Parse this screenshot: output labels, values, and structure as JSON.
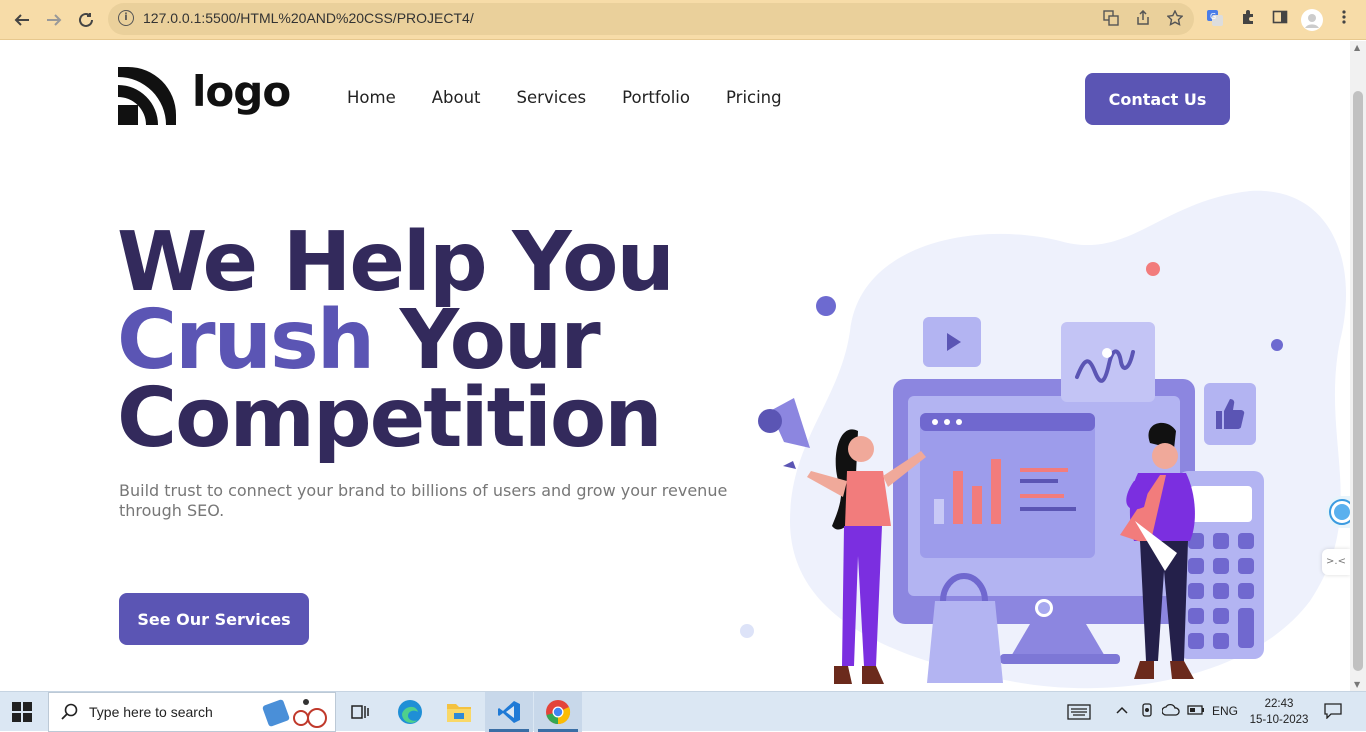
{
  "browser": {
    "url": "127.0.0.1:5500/HTML%20AND%20CSS/PROJECT4/",
    "icons": [
      "back-icon",
      "forward-icon",
      "reload-icon",
      "site-info-icon",
      "translate-icon",
      "share-icon",
      "bookmark-star-icon",
      "google-translate-ext-icon",
      "extensions-puzzle-icon",
      "sidepanel-icon",
      "profile-avatar-icon",
      "menu-dots-icon"
    ]
  },
  "header": {
    "logo_text": "logo",
    "nav": [
      "Home",
      "About",
      "Services",
      "Portfolio",
      "Pricing"
    ],
    "contact_label": "Contact Us"
  },
  "hero": {
    "line1": "We Help You",
    "line2_accent": "Crush",
    "line2_rest": " Your",
    "line3": "Competition",
    "subtitle": "Build trust to connect your brand to billions of users and grow your revenue through SEO.",
    "cta_label": "See Our Services"
  },
  "colors": {
    "primary": "#5b55b4",
    "heading": "#332a5c",
    "browser_bar": "#f7dca8"
  },
  "taskbar": {
    "search_placeholder": "Type here to search",
    "apps": [
      "task-view-icon",
      "edge-icon",
      "file-explorer-icon",
      "vscode-icon",
      "chrome-icon"
    ],
    "language": "ENG",
    "time": "22:43",
    "date": "15-10-2023"
  }
}
